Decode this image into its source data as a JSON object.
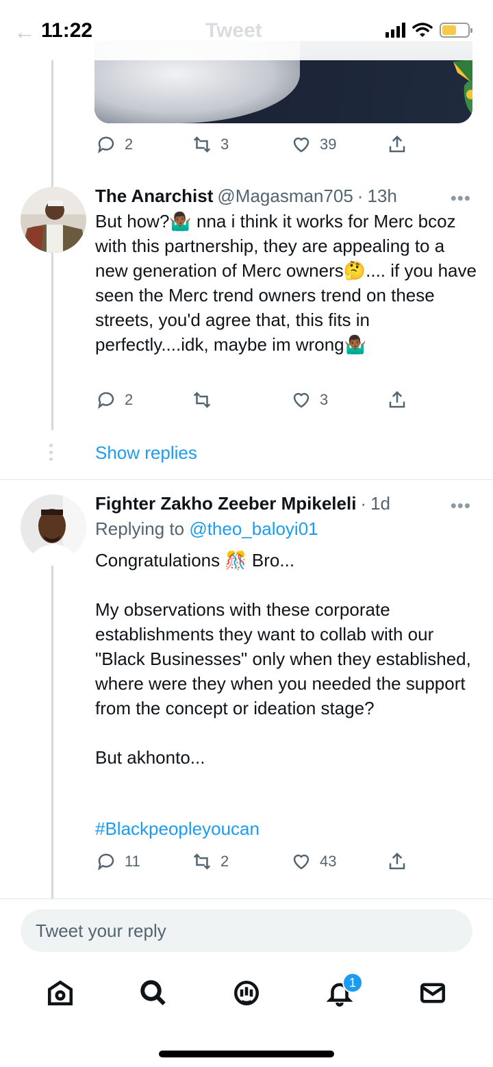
{
  "status_bar": {
    "time": "11:22"
  },
  "header": {
    "title": "Tweet"
  },
  "tweets": [
    {
      "actions": {
        "reply_count": "2",
        "retweet_count": "3",
        "like_count": "39"
      }
    },
    {
      "name": "The Anarchist",
      "handle": "@Magasman705",
      "dot": "·",
      "time": "13h",
      "text": "But how?🤷🏾‍♂️ nna i think it works for Merc bcoz with this partnership, they are appealing to a new generation of Merc owners🤔.... if you have seen the Merc trend owners trend on these streets, you'd agree that, this fits in perfectly....idk, maybe im wrong🤷🏾‍♂️",
      "actions": {
        "reply_count": "2",
        "retweet_count": "",
        "like_count": "3"
      },
      "show_replies": "Show replies"
    },
    {
      "name": "Fighter Zakho Zeeber Mpikeleli",
      "dot": "·",
      "time": "1d",
      "replying_prefix": "Replying to ",
      "replying_handle": "@theo_baloyi01",
      "text": "Congratulations 🎊 Bro...\n\nMy observations with these corporate establishments they want to collab with our \"Black Businesses\" only when they established, where were they when you needed the support from the concept or ideation stage?\n\nBut akhonto...",
      "hashtag": "#Blackpeopleyoucan",
      "actions": {
        "reply_count": "11",
        "retweet_count": "2",
        "like_count": "43"
      }
    }
  ],
  "more_label": "•••",
  "reply_input": {
    "placeholder": "Tweet your reply"
  },
  "tabbar": {
    "items": [
      {
        "icon": "home-icon"
      },
      {
        "icon": "search-icon"
      },
      {
        "icon": "spaces-icon"
      },
      {
        "icon": "bell-icon",
        "badge": "1"
      },
      {
        "icon": "mail-icon"
      }
    ]
  }
}
